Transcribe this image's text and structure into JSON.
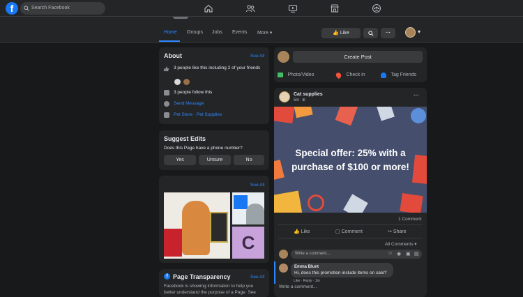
{
  "topbar": {
    "search_placeholder": "Search Facebook",
    "nav_icons": [
      "home-icon",
      "friends-icon",
      "watch-icon",
      "marketplace-icon",
      "groups-icon"
    ],
    "brand_color": "#1877f2"
  },
  "page_nav": {
    "tabs": [
      "Home",
      "Groups",
      "Jobs",
      "Events",
      "More"
    ],
    "like_label": "Like"
  },
  "about": {
    "title": "About",
    "see_all": "See All",
    "likes_text": "3 people like this including 2 of your friends",
    "follows_text": "3 people follow this",
    "send_message": "Send Message",
    "category": "Pet Store · Pet Supplies"
  },
  "suggest": {
    "title": "Suggest Edits",
    "question": "Does this Page have a phone number?",
    "buttons": [
      "Yes",
      "Unsure",
      "No"
    ]
  },
  "photos": {
    "see_all": "See All",
    "tile_letter": "C"
  },
  "transparency": {
    "title": "Page Transparency",
    "see_all": "See All",
    "text_line1": "Facebook is showing information to help you",
    "text_line2": "better understand the purpose of a Page. See"
  },
  "composer": {
    "create_post": "Create Post",
    "photo_video": "Photo/Video",
    "check_in": "Check in",
    "tag_friends": "Tag Friends"
  },
  "post": {
    "author": "Cat supplies",
    "time": "5m",
    "more": "···",
    "offer_line1": "Special offer: 25% with a",
    "offer_line2": "purchase of $100 or more!",
    "comment_count": "1 Comment",
    "actions": [
      "Like",
      "Comment",
      "Share"
    ],
    "all_comments": "All Comments",
    "write_placeholder": "Write a comment...",
    "comment": {
      "author": "Emma Blunt",
      "text": "Hi, does this promotion include items on sale?",
      "meta": "Like · Reply · 1m"
    },
    "write_reply": "Write a comment..."
  }
}
